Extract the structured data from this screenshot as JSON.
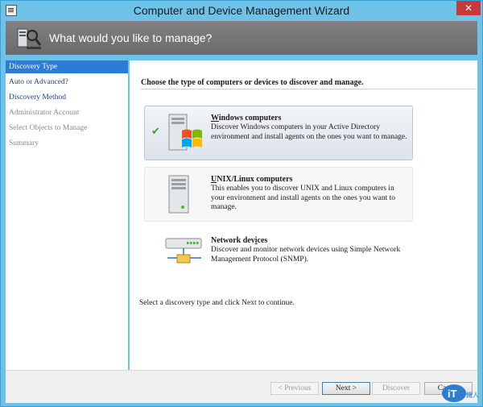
{
  "window": {
    "title": "Computer and Device Management Wizard",
    "close_glyph": "✕"
  },
  "banner": {
    "text": "What would you like to manage?",
    "icon": "discovery-wizard-icon"
  },
  "sidebar": {
    "items": [
      {
        "label": "Discovery Type",
        "state": "active"
      },
      {
        "label": "Auto or Advanced?",
        "state": "link"
      },
      {
        "label": "Discovery Method",
        "state": "link"
      },
      {
        "label": "Administrator Account",
        "state": "disabled"
      },
      {
        "label": "Select Objects to Manage",
        "state": "disabled"
      },
      {
        "label": "Summary",
        "state": "disabled"
      }
    ]
  },
  "main": {
    "heading": "Choose the type of computers or devices to discover and manage.",
    "options": [
      {
        "title_ul": "W",
        "title_rest": "indows computers",
        "description": "Discover Windows computers in your Active Directory environment and install agents on the ones you want to manage.",
        "selected": true,
        "icon": "windows-server-icon"
      },
      {
        "title_ul": "U",
        "title_rest": "NIX/Linux computers",
        "description": "This enables you to discover UNIX and Linux computers in your environment and install agents on the ones you want to manage.",
        "selected": false,
        "icon": "unix-server-icon"
      },
      {
        "title_pre": "Network dev",
        "title_ul": "i",
        "title_rest": "ces",
        "description": "Discover and monitor network devices using Simple Network Management Protocol (SNMP).",
        "selected": false,
        "icon": "network-switch-icon"
      }
    ],
    "hint": "Select a discovery type and click Next to continue."
  },
  "footer": {
    "previous_label": "< Previous",
    "next_label": "Next >",
    "discover_label": "Discover",
    "cancel_label": "Cancel"
  },
  "watermark": {
    "text": "iThome",
    "sub": "鐵人賽"
  },
  "colors": {
    "accent": "#2d7bd6",
    "frame": "#6ec2e8",
    "banner": "#777777",
    "close": "#c7393a"
  }
}
